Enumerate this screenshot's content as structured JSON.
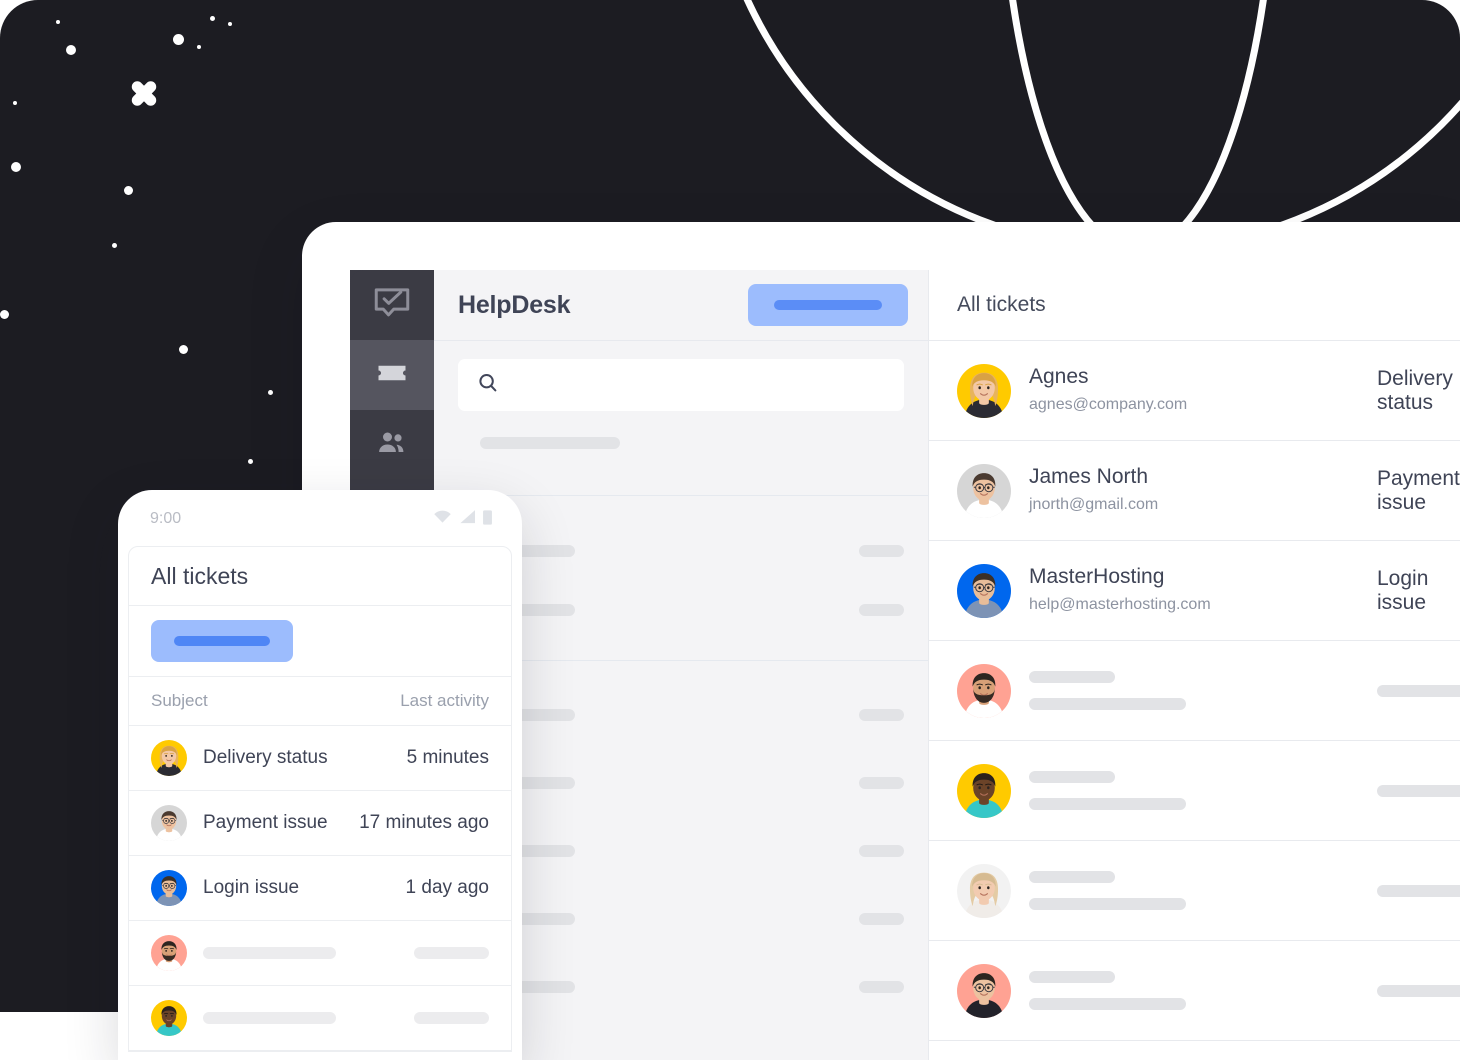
{
  "colors": {
    "backdrop": "#1c1c22",
    "rail": "#3b3b44",
    "rail_active": "#55555f",
    "accent_light": "#9cbcfd",
    "accent": "#5b8df6",
    "panel_bg": "#f4f4f6",
    "text_dark": "#3f4456",
    "text_muted": "#8d93a1"
  },
  "desktop": {
    "brand": "HelpDesk",
    "rail_items": [
      {
        "name": "logo",
        "icon": "chat-check-icon",
        "active": false
      },
      {
        "name": "tickets",
        "icon": "ticket-icon",
        "active": true
      },
      {
        "name": "contacts",
        "icon": "people-icon",
        "active": false
      }
    ],
    "primary_button_label": "",
    "search": {
      "placeholder": "",
      "value": "",
      "icon": "search-icon"
    },
    "skeleton_rows": 7,
    "list": {
      "title": "All tickets",
      "rows": [
        {
          "name": "Agnes",
          "email": "agnes@company.com",
          "subject": "Delivery status",
          "avatar": "woman-blonde",
          "avatar_bg": "#ffca00",
          "placeholder": false
        },
        {
          "name": "James North",
          "email": "jnorth@gmail.com",
          "subject": "Payment issue",
          "avatar": "man-glasses-grey",
          "avatar_bg": "#d6d6d6",
          "placeholder": false
        },
        {
          "name": "MasterHosting",
          "email": "help@masterhosting.com",
          "subject": "Login issue",
          "avatar": "man-glasses-blue",
          "avatar_bg": "#0067ee",
          "placeholder": false
        },
        {
          "name": "",
          "email": "",
          "subject": "",
          "avatar": "man-beard",
          "avatar_bg": "#ffa293",
          "placeholder": true
        },
        {
          "name": "",
          "email": "",
          "subject": "",
          "avatar": "man-smiling-yellow",
          "avatar_bg": "#ffca00",
          "placeholder": true
        },
        {
          "name": "",
          "email": "",
          "subject": "",
          "avatar": "woman-blonde-light",
          "avatar_bg": "#f2f2f2",
          "placeholder": true
        },
        {
          "name": "",
          "email": "",
          "subject": "",
          "avatar": "man-glasses-coral",
          "avatar_bg": "#ffa293",
          "placeholder": true
        }
      ]
    }
  },
  "phone": {
    "status": {
      "time": "9:00",
      "icons": [
        "wifi-icon",
        "signal-icon",
        "battery-icon"
      ]
    },
    "title": "All tickets",
    "primary_button_label": "",
    "columns": {
      "subject": "Subject",
      "last_activity": "Last activity"
    },
    "rows": [
      {
        "subject": "Delivery status",
        "time": "5 minutes",
        "avatar": "woman-blonde",
        "avatar_bg": "#ffca00",
        "placeholder": false
      },
      {
        "subject": "Payment issue",
        "time": "17 minutes ago",
        "avatar": "man-glasses-grey",
        "avatar_bg": "#d6d6d6",
        "placeholder": false
      },
      {
        "subject": "Login issue",
        "time": "1 day ago",
        "avatar": "man-glasses-blue",
        "avatar_bg": "#0067ee",
        "placeholder": false
      },
      {
        "subject": "",
        "time": "",
        "avatar": "man-beard",
        "avatar_bg": "#ffa293",
        "placeholder": true
      },
      {
        "subject": "",
        "time": "",
        "avatar": "man-smiling-yellow",
        "avatar_bg": "#ffca00",
        "placeholder": true
      }
    ]
  },
  "decor": {
    "x_marker": "x-sparkle-icon",
    "globe_lines": "globe-wireframe",
    "stars": 14
  }
}
